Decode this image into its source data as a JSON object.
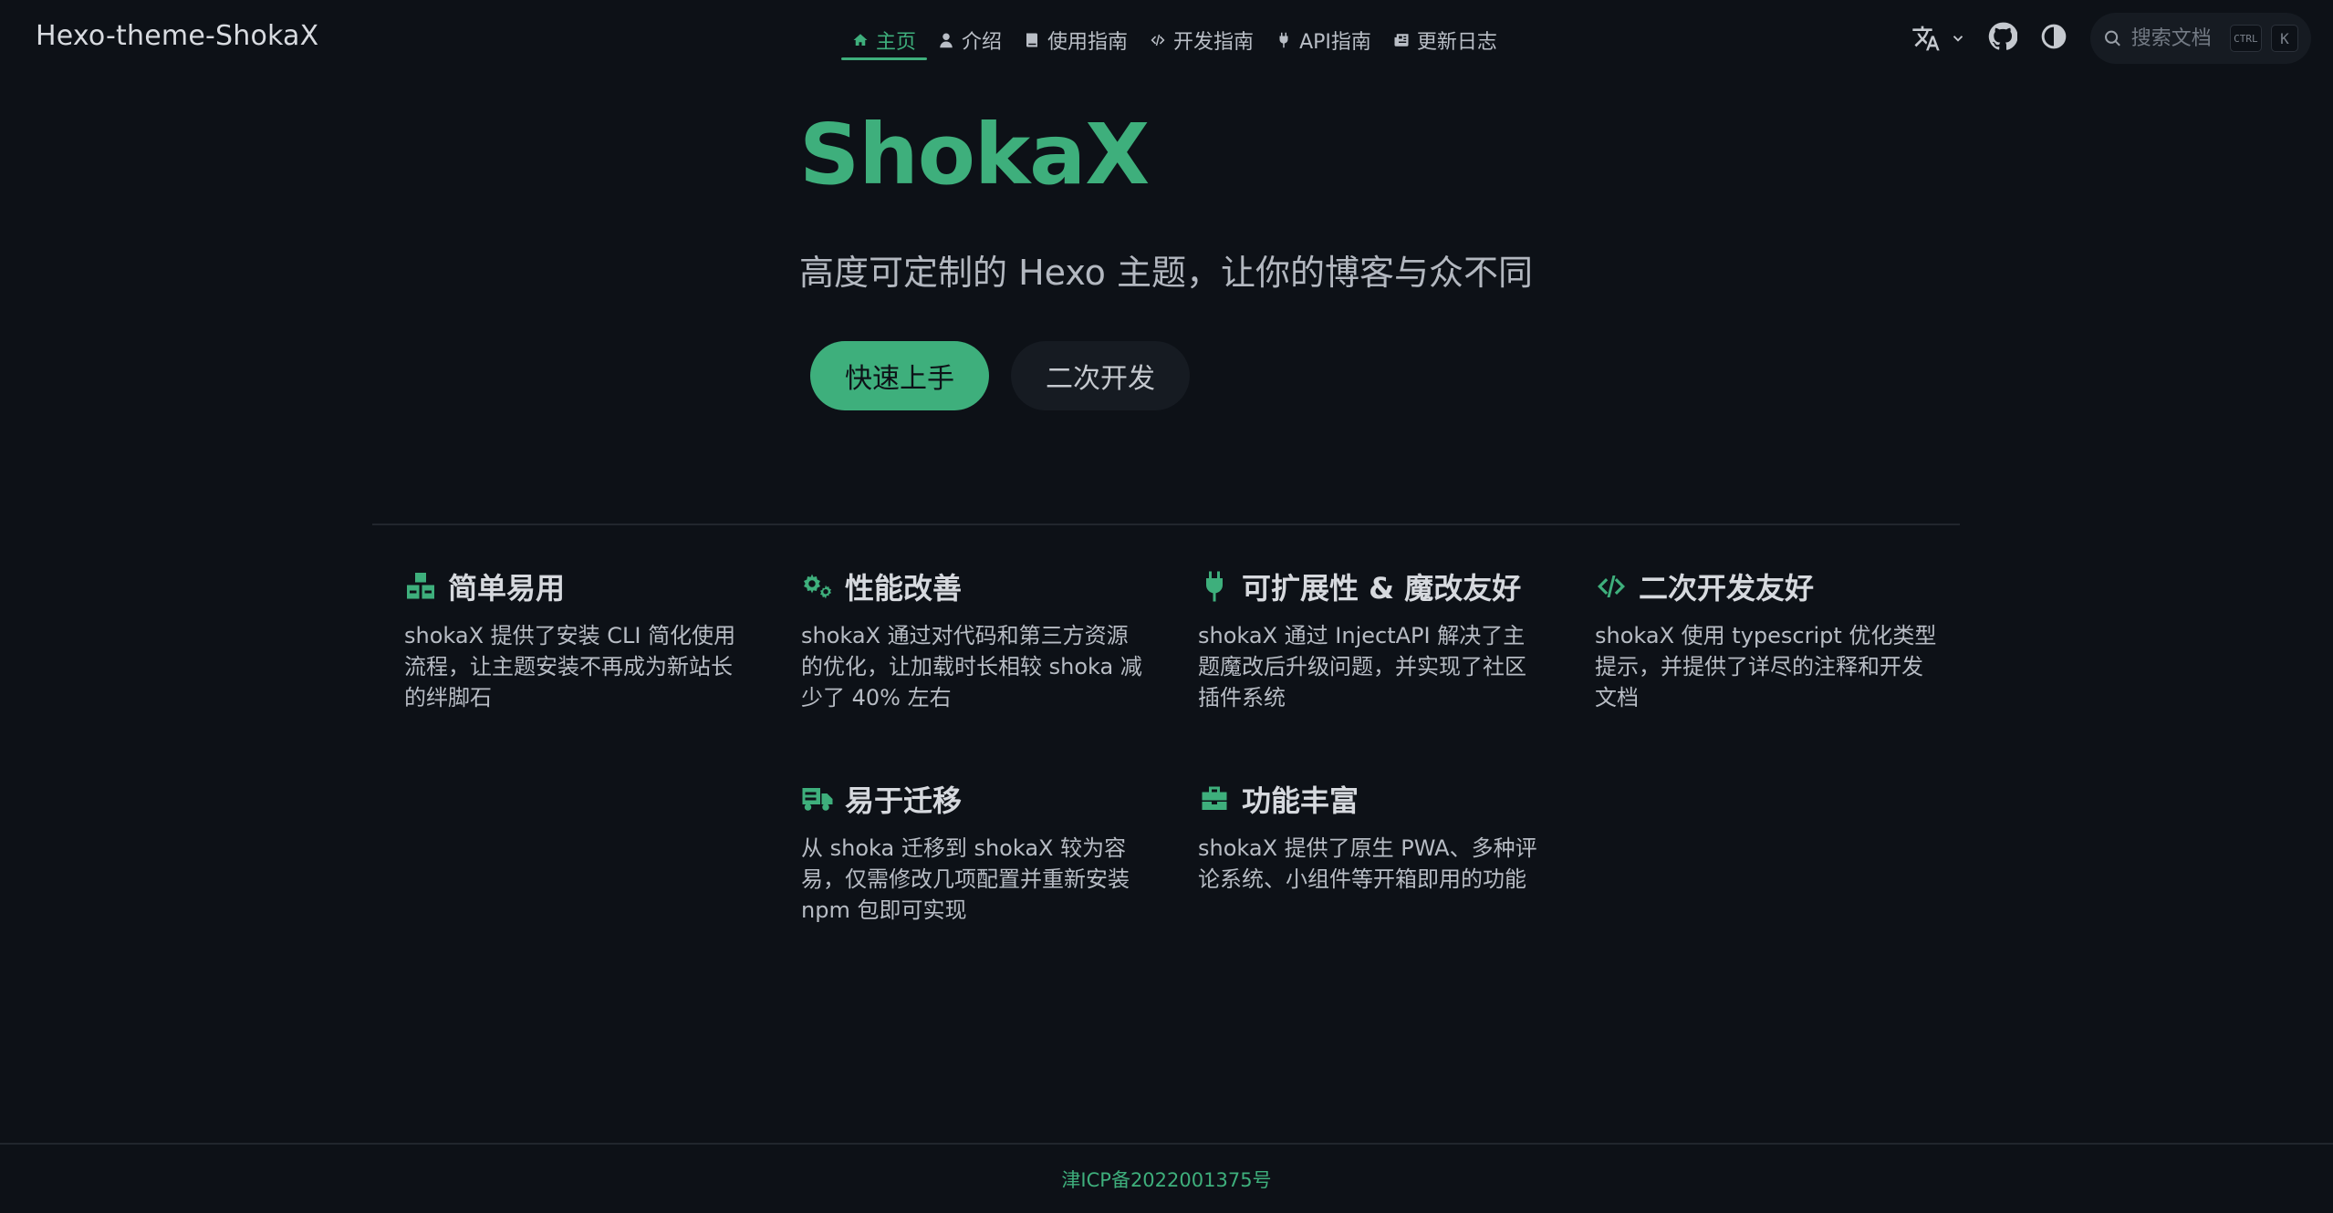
{
  "navbar": {
    "site_title": "Hexo-theme-ShokaX",
    "links": [
      {
        "label": "主页",
        "icon": "home-icon",
        "active": true
      },
      {
        "label": "介绍",
        "icon": "user-icon",
        "active": false
      },
      {
        "label": "使用指南",
        "icon": "book-icon",
        "active": false
      },
      {
        "label": "开发指南",
        "icon": "code-icon",
        "active": false
      },
      {
        "label": "API指南",
        "icon": "plug-icon",
        "active": false
      },
      {
        "label": "更新日志",
        "icon": "newspaper-icon",
        "active": false
      }
    ],
    "search": {
      "placeholder": "搜索文档",
      "shortcut_ctrl": "CTRL",
      "shortcut_key": "K"
    },
    "icons": [
      "translate-icon",
      "github-icon",
      "theme-toggle-icon",
      "search-icon"
    ]
  },
  "hero": {
    "title": "ShokaX",
    "tagline": "高度可定制的 Hexo 主题，让你的博客与众不同",
    "primary_action": "快速上手",
    "secondary_action": "二次开发"
  },
  "features": [
    {
      "title": "简单易用",
      "icon": "cubes-icon",
      "desc": "shokaX 提供了安装 CLI 简化使用流程，让主题安装不再成为新站长的绊脚石"
    },
    {
      "title": "性能改善",
      "icon": "gears-icon",
      "desc": "shokaX 通过对代码和第三方资源的优化，让加载时长相较 shoka 减少了 40% 左右"
    },
    {
      "title": "可扩展性 & 魔改友好",
      "icon": "plug-icon",
      "desc": "shokaX 通过 InjectAPI 解决了主题魔改后升级问题，并实现了社区插件系统"
    },
    {
      "title": "二次开发友好",
      "icon": "code-icon",
      "desc": "shokaX 使用 typescript 优化类型提示，并提供了详尽的注释和开发文档"
    },
    {
      "title": "易于迁移",
      "icon": "truck-icon",
      "desc": "从 shoka 迁移到 shokaX 较为容易，仅需修改几项配置并重新安装 npm 包即可实现"
    },
    {
      "title": "功能丰富",
      "icon": "toolbox-icon",
      "desc": "shokaX 提供了原生 PWA、多种评论系统、小组件等开箱即用的功能"
    }
  ],
  "footer": {
    "icp": "津ICP备2022001375号"
  },
  "colors": {
    "accent": "#3eaf7c",
    "background": "#0d1117"
  }
}
